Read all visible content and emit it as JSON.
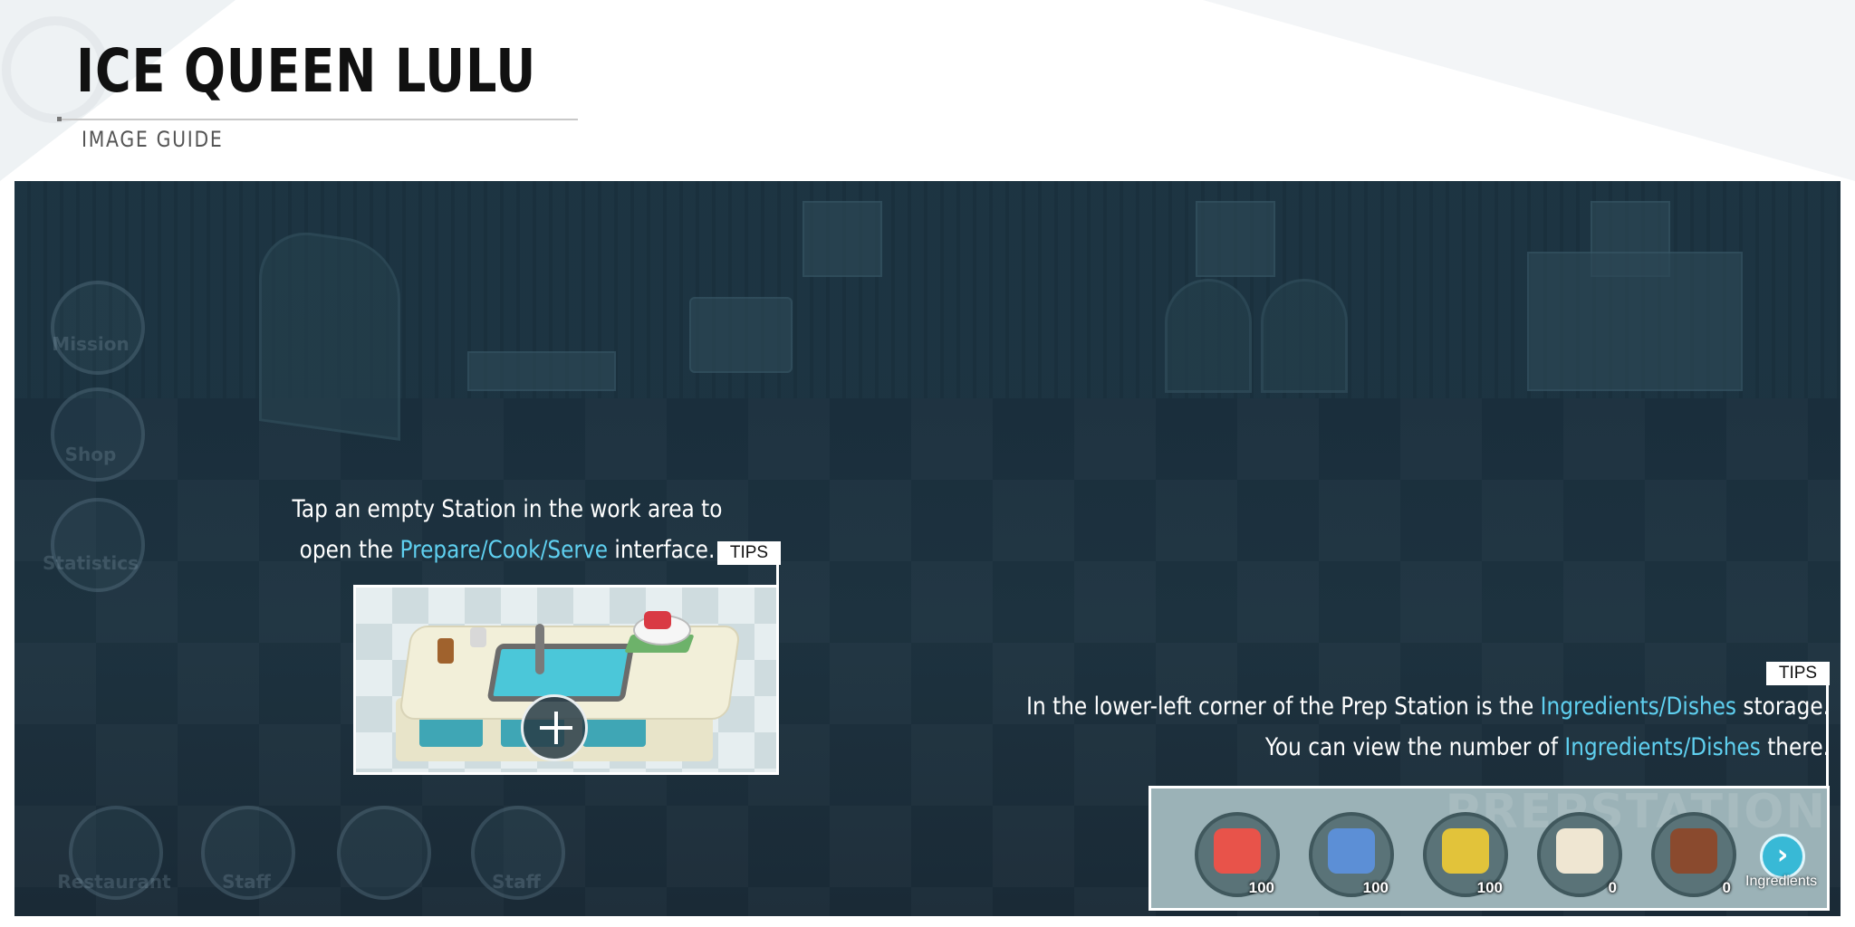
{
  "header": {
    "title": "ICE QUEEN LULU",
    "subtitle": "IMAGE GUIDE"
  },
  "game_bg": {
    "left_menu": [
      "Mission",
      "Shop",
      "Statistics"
    ],
    "bottom_menu": [
      "Restaurant",
      "Staff",
      "",
      "Staff"
    ]
  },
  "tip1": {
    "badge": "TIPS",
    "line1": "Tap an empty Station in the work area to",
    "line2_pre": "open the ",
    "line2_hl": "Prepare/Cook/Serve",
    "line2_post": " interface."
  },
  "tip2": {
    "badge": "TIPS",
    "line1_pre": "In the lower-left corner of the Prep Station is the ",
    "line1_hl": "Ingredients/Dishes",
    "line1_post": " storage.",
    "line2_pre": "You can view the number of ",
    "line2_hl": "Ingredients/Dishes",
    "line2_post": " there.",
    "bg_watermark": "PREPSTATION",
    "items": [
      {
        "name": "fruit-platter-icon",
        "count": "100",
        "color": "#e8534a"
      },
      {
        "name": "milk-carton-icon",
        "count": "100",
        "color": "#5c8fd6"
      },
      {
        "name": "sugar-bag-icon",
        "count": "100",
        "color": "#e2c33a"
      },
      {
        "name": "flour-sack-icon",
        "count": "0",
        "color": "#efe6d2"
      },
      {
        "name": "grilled-meat-icon",
        "count": "0",
        "color": "#8a4a2e"
      }
    ],
    "ingredients_label": "Ingredients",
    "arrow_glyph": "›"
  }
}
